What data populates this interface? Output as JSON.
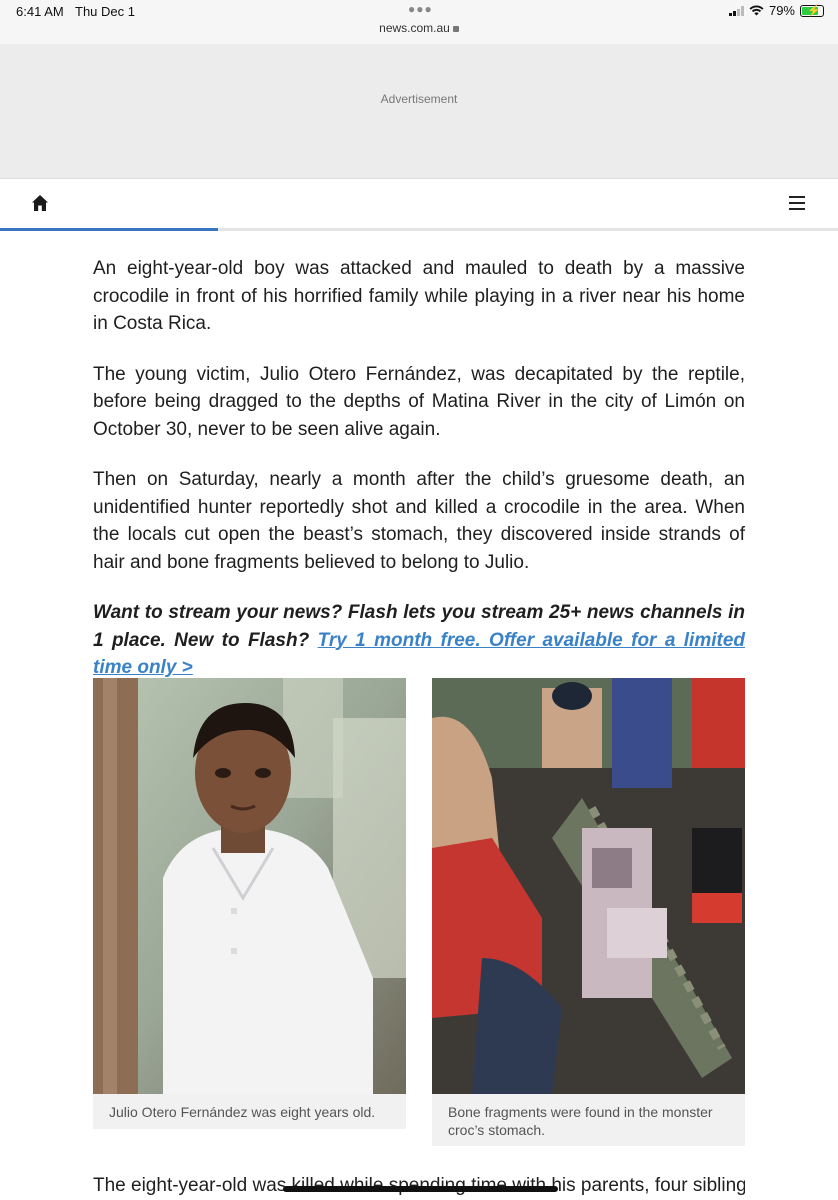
{
  "status": {
    "time": "6:41 AM",
    "date": "Thu Dec 1",
    "url": "news.com.au",
    "battery": "79%",
    "battery_level": 0.79
  },
  "ad": {
    "label": "Advertisement"
  },
  "nav": {
    "home_icon": "home-icon",
    "menu_icon": "hamburger-menu-icon",
    "accent": "#3a75c4"
  },
  "article": {
    "paragraphs": [
      "An eight-year-old boy was attacked and mauled to death by a massive crocodile in front of his horrified family while playing in a river near his home in Costa Rica.",
      "The young victim, Julio Otero Fernández, was decapitated by the reptile, before being dragged to the depths of Matina River in the city of Limón on October 30, never to be seen alive again.",
      "Then on Saturday, nearly a month after the child’s gruesome death, an unidentified hunter reportedly shot and killed a crocodile in the area. When the locals cut open the beast’s stomach, they discovered inside strands of hair and bone fragments believed to belong to Julio."
    ],
    "promo_text": "Want to stream your news? Flash lets you stream 25+ news channels in 1 place. New to Flash? ",
    "promo_link": "Try 1 month free. Offer available for a limited time only >",
    "link_color": "#3a82c8",
    "figures": [
      {
        "caption": "Julio Otero Fernández was eight years old."
      },
      {
        "caption": "Bone fragments were found in the monster croc’s stomach."
      }
    ],
    "last_line": "The eight-year-old was killed while spending time with his parents, four siblings"
  }
}
